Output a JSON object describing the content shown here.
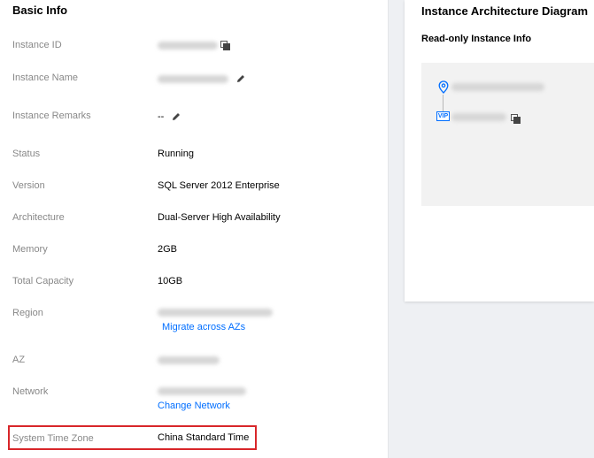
{
  "basic_info": {
    "title": "Basic Info",
    "rows": {
      "instance_id": {
        "label": "Instance ID"
      },
      "instance_name": {
        "label": "Instance Name"
      },
      "instance_remarks": {
        "label": "Instance Remarks",
        "value": "--"
      },
      "status": {
        "label": "Status",
        "value": "Running"
      },
      "version": {
        "label": "Version",
        "value": "SQL Server 2012 Enterprise"
      },
      "architecture": {
        "label": "Architecture",
        "value": "Dual-Server High Availability"
      },
      "memory": {
        "label": "Memory",
        "value": "2GB"
      },
      "total_capacity": {
        "label": "Total Capacity",
        "value": "10GB"
      },
      "region": {
        "label": "Region",
        "link": "Migrate across AZs"
      },
      "az": {
        "label": "AZ"
      },
      "network": {
        "label": "Network",
        "link": "Change Network"
      },
      "system_time_zone": {
        "label": "System Time Zone",
        "value": "China Standard Time"
      }
    }
  },
  "architecture_diagram": {
    "title": "Instance Architecture Diagram",
    "subtitle": "Read-only Instance Info",
    "vip_badge": "VIP"
  },
  "icons": {
    "copy": "copy-icon",
    "edit": "pencil-icon",
    "location": "location-pin-icon"
  },
  "colors": {
    "link": "#006eff",
    "highlight": "#d8262a",
    "label": "#888888"
  }
}
